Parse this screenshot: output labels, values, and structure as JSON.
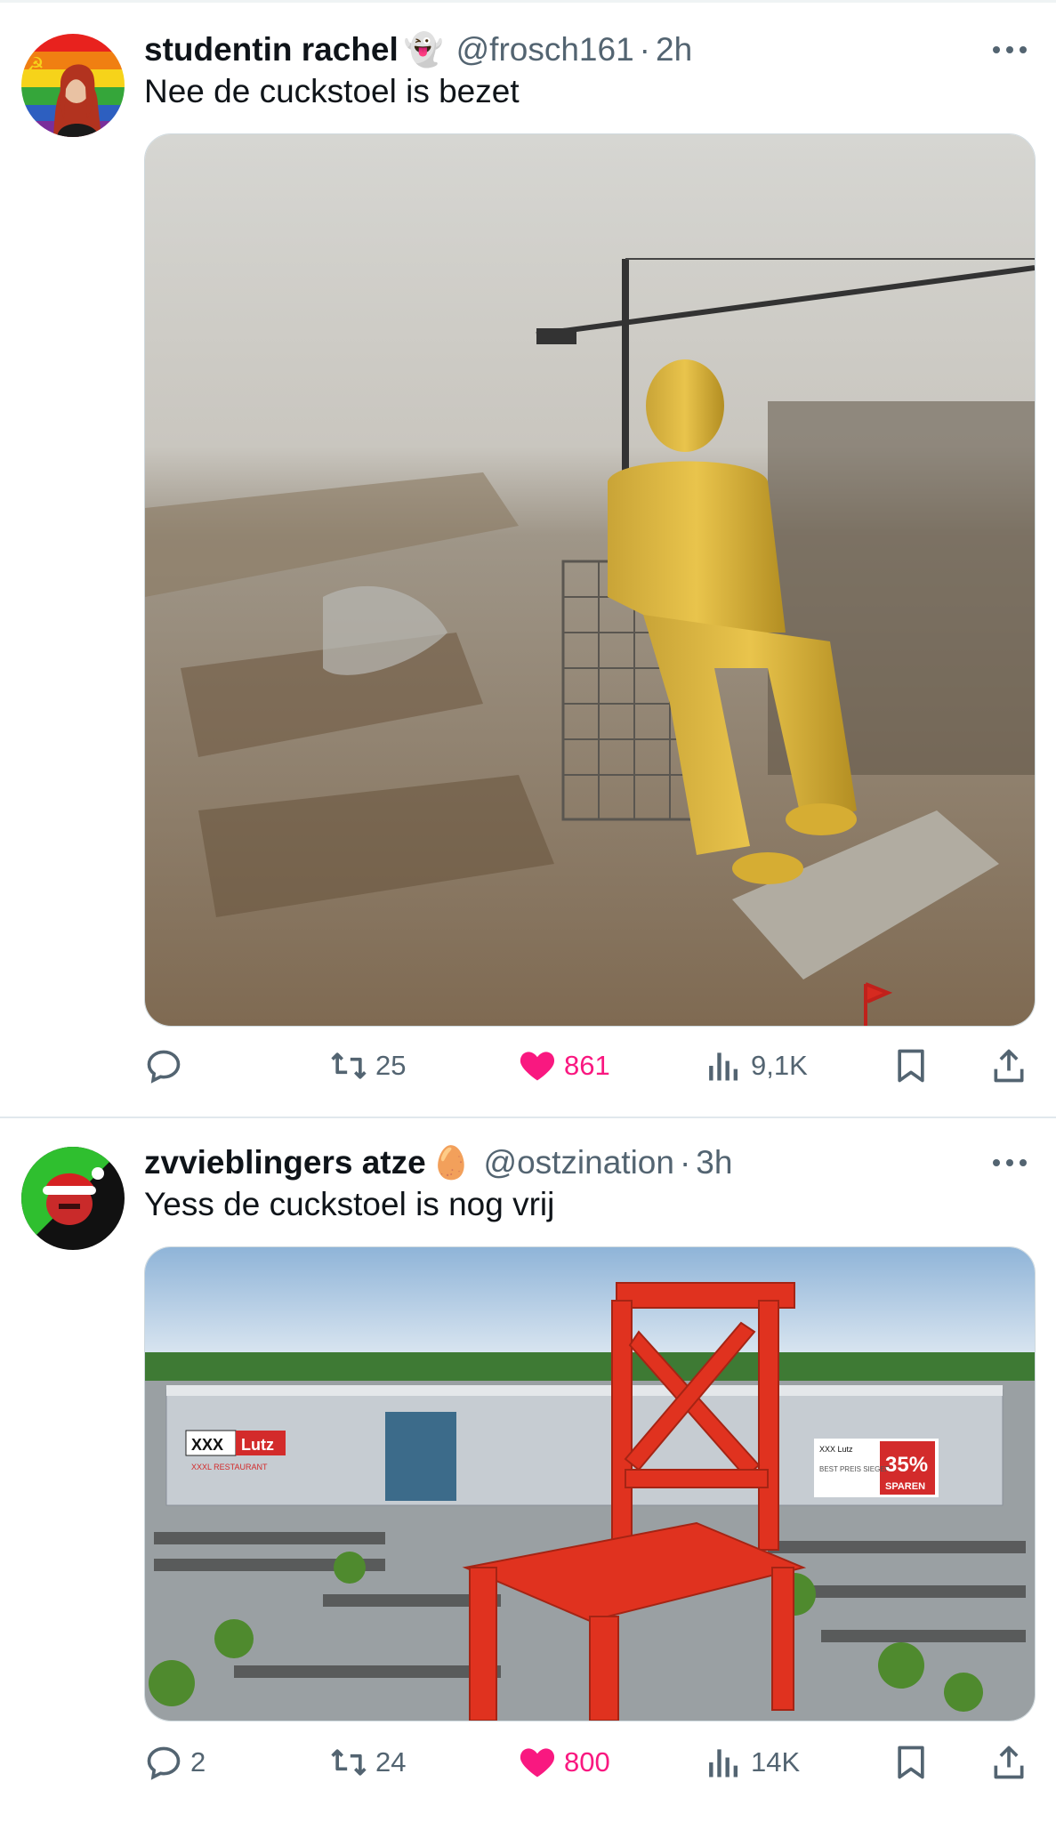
{
  "colors": {
    "like": "#f91880",
    "muted": "#536471",
    "text": "#0f1419"
  },
  "tweets": [
    {
      "display_name": "studentin rachel",
      "badge": "👻",
      "handle": "@frosch161",
      "separator": "·",
      "time": "2h",
      "text": "Nee de cuckstoel is bezet",
      "image_subject": "golden-seated-statue-construction-site",
      "stats": {
        "replies": "",
        "retweets": "25",
        "likes": "861",
        "views": "9,1K"
      }
    },
    {
      "display_name": "zvvieblingers atze",
      "badge": "🥚",
      "handle": "@ostzination",
      "separator": "·",
      "time": "3h",
      "text": "Yess de cuckstoel is nog vrij",
      "image_subject": "giant-red-chair-furniture-store",
      "image_signs": {
        "store_logo_left": "XXX",
        "store_logo_right": "Lutz",
        "sub_sign": "XXXL RESTAURANT",
        "banner_small": "XXX Lutz",
        "banner_best": "BEST PREIS SIEGER",
        "banner_pct": "35%",
        "banner_sparen": "SPAREN"
      },
      "stats": {
        "replies": "2",
        "retweets": "24",
        "likes": "800",
        "views": "14K"
      }
    }
  ]
}
